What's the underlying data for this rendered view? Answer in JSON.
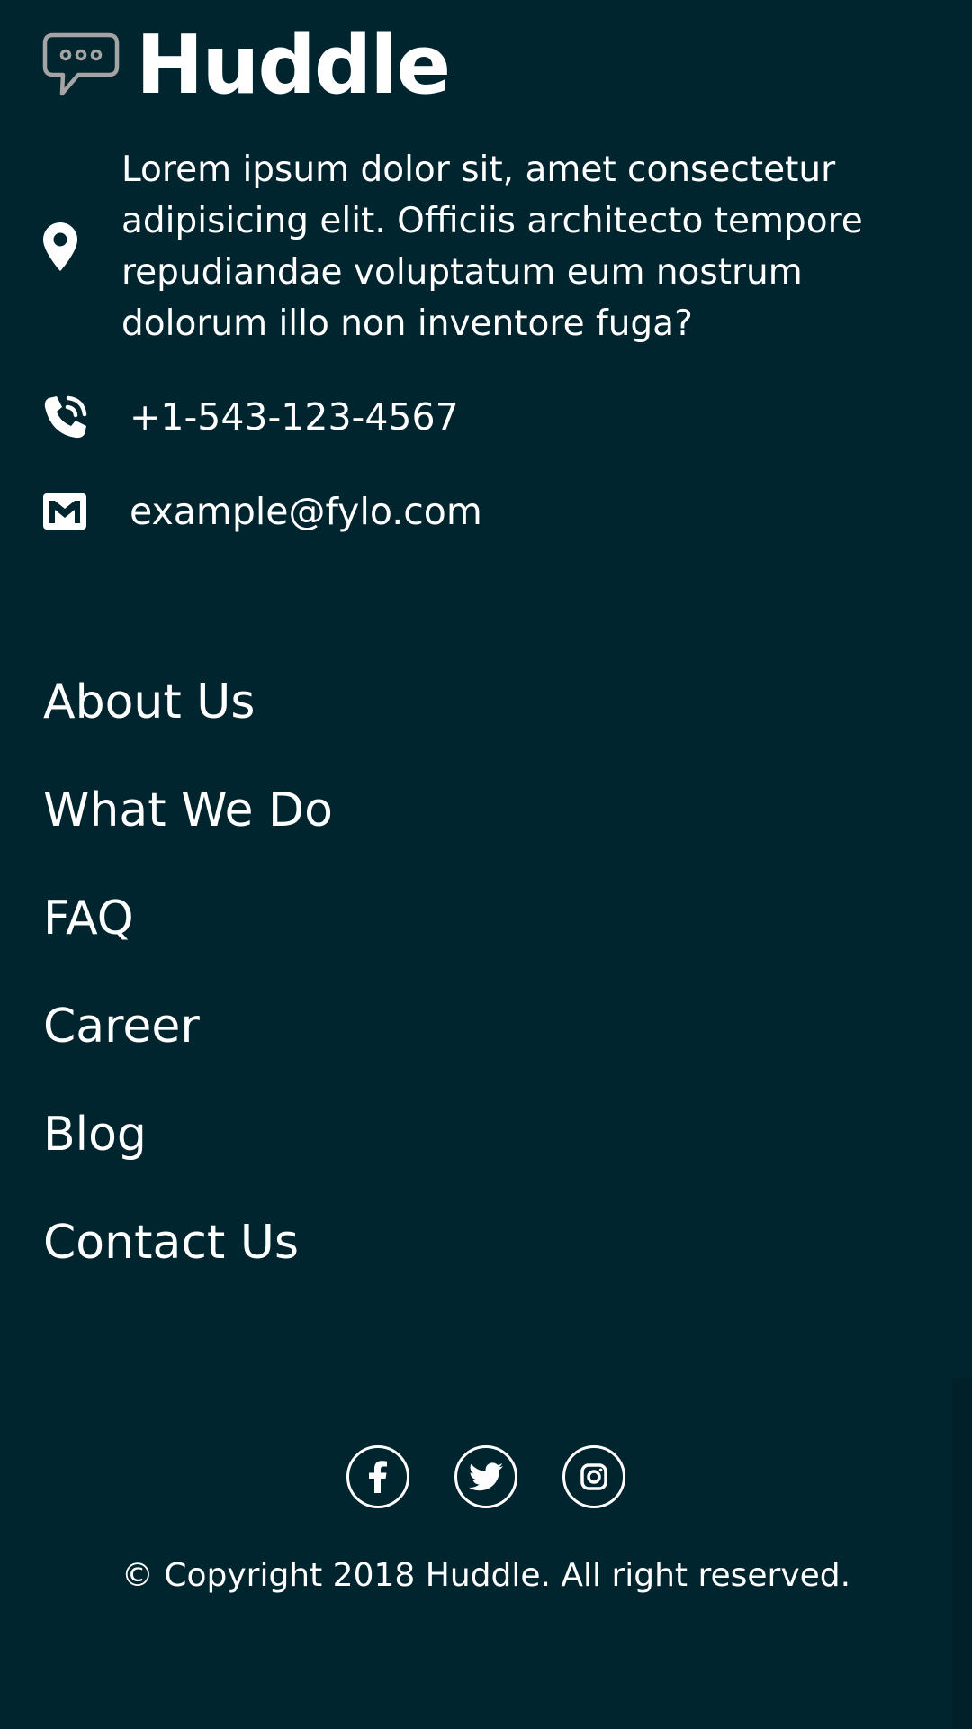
{
  "brand": {
    "name": "Huddle",
    "logo_icon": "chat-bubble-icon"
  },
  "contact": {
    "address": "Lorem ipsum dolor sit, amet consectetur adipisicing elit. Officiis architecto tempore repudiandae voluptatum eum nostrum dolorum illo non inventore fuga?",
    "address_icon": "location-pin-icon",
    "phone": "+1-543-123-4567",
    "phone_icon": "phone-icon",
    "email": "example@fylo.com",
    "email_icon": "mail-icon"
  },
  "nav": {
    "items": [
      {
        "label": "About Us"
      },
      {
        "label": "What We Do"
      },
      {
        "label": "FAQ"
      },
      {
        "label": "Career"
      },
      {
        "label": "Blog"
      },
      {
        "label": "Contact Us"
      }
    ]
  },
  "social": {
    "icons": [
      "facebook-icon",
      "twitter-icon",
      "instagram-icon"
    ]
  },
  "footer": {
    "copyright": "© Copyright 2018 Huddle. All right reserved."
  },
  "colors": {
    "background": "#00252e",
    "text": "#ffffff",
    "logo_icon_stroke": "#a4a4a4"
  }
}
